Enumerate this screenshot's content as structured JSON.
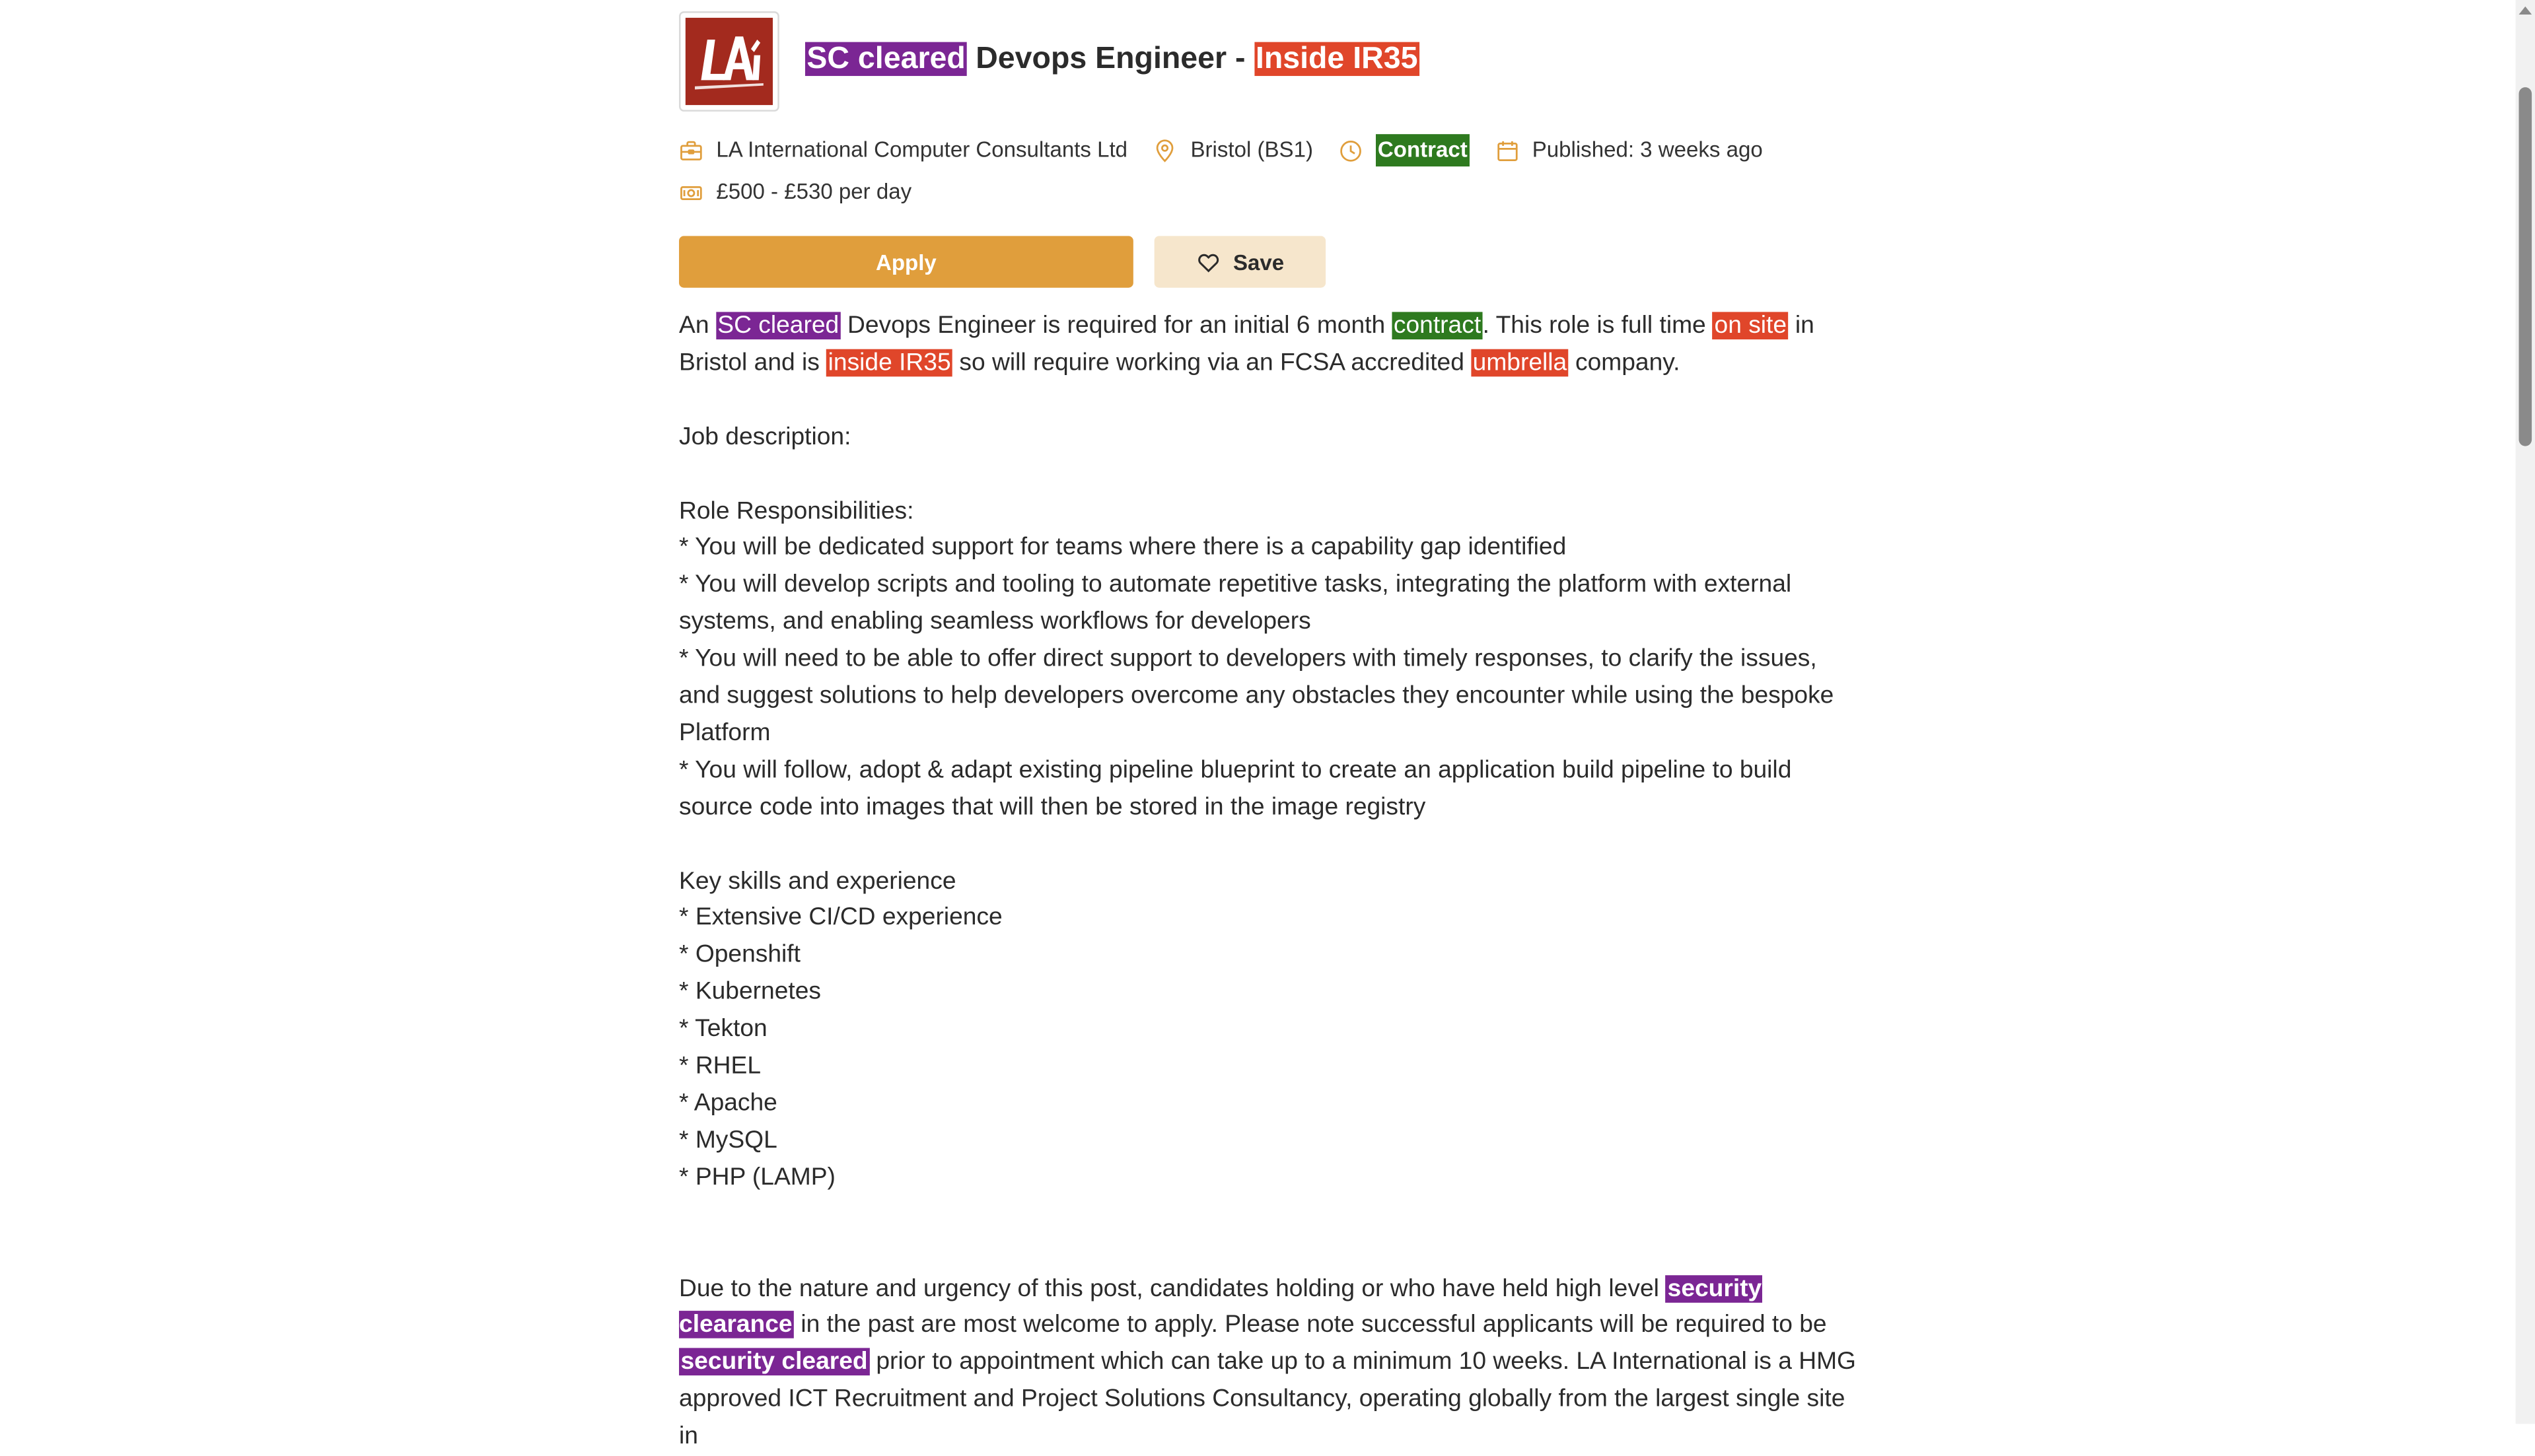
{
  "job": {
    "title_parts": [
      {
        "text": "SC cleared",
        "style": "purple"
      },
      {
        "text": " Devops Engineer - ",
        "style": "plain"
      },
      {
        "text": "Inside IR35",
        "style": "red"
      }
    ],
    "company": "LA International Computer Consultants Ltd",
    "location": "Bristol (BS1)",
    "type": "Contract",
    "published": "Published: 3 weeks ago",
    "salary": "£500 - £530 per day",
    "logo_icon": "la-international-logo",
    "logo_text": "LAi"
  },
  "buttons": {
    "apply_label": "Apply",
    "save_label": "Save"
  },
  "colors": {
    "accent": "#e09e3c",
    "save_bg": "#f6e6cc",
    "highlight_purple": "#7b2694",
    "highlight_red": "#e0462a",
    "highlight_green": "#2e7a1f",
    "logo_bg": "#a32a1e"
  },
  "icons": {
    "company": "briefcase-icon",
    "location": "map-pin-icon",
    "type": "clock-icon",
    "published": "calendar-icon",
    "salary": "money-icon",
    "save": "heart-icon"
  },
  "description": {
    "intro": {
      "t1": "An ",
      "h1": "SC cleared",
      "t2": " Devops Engineer is required for an initial 6 month ",
      "h2": "contract",
      "t3": ". This role is full time ",
      "h3": "on site",
      "t4": " in Bristol and is ",
      "h4": "inside IR35",
      "t5": " so will require working via an FCSA accredited ",
      "h5": "umbrella",
      "t6": " company."
    },
    "job_description_heading": "Job description:",
    "responsibilities_heading": "Role Responsibilities:",
    "responsibilities": [
      "* You will be dedicated support for teams where there is a capability gap identified",
      "* You will develop scripts and tooling to automate repetitive tasks, integrating the platform with external systems, and enabling seamless workflows for developers",
      "* You will need to be able to offer direct support to developers with timely responses, to clarify the issues, and suggest solutions to help developers overcome any obstacles they encounter while using the bespoke Platform",
      "* You will follow, adopt & adapt existing pipeline blueprint to create an application build pipeline to build source code into images that will then be stored in the image registry"
    ],
    "skills_heading": "Key skills and experience",
    "skills": [
      "* Extensive CI/CD experience",
      "* Openshift",
      "* Kubernetes",
      "* Tekton",
      "* RHEL",
      "* Apache",
      "* MySQL",
      "* PHP (LAMP)"
    ],
    "closing": {
      "t1": "Due to the nature and urgency of this post, candidates holding or who have held high level ",
      "h1": "security clearance",
      "t2": " in the past are most welcome to apply. Please note successful applicants will be required to be ",
      "h2": "security cleared",
      "t3": " prior to appointment which can take up to a minimum 10 weeks. LA International is a HMG approved ICT Recruitment and Project Solutions Consultancy, operating globally from the largest single site in"
    }
  }
}
